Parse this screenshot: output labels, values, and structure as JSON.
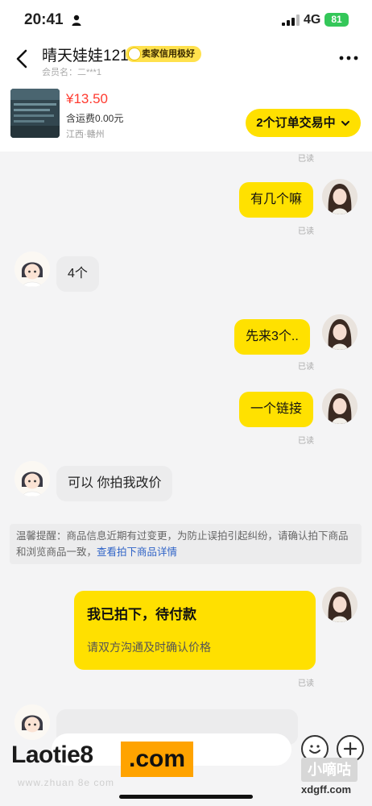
{
  "status_bar": {
    "time": "20:41",
    "network": "4G",
    "battery": "81"
  },
  "header": {
    "title": "晴天娃娃121",
    "seller_badge": "卖家信用极好",
    "subtitle": "会员名：二***1"
  },
  "product": {
    "price": "¥13.50",
    "shipping": "含运费0.00元",
    "location": "江西·赣州",
    "orders_button": "2个订单交易中"
  },
  "chat": {
    "top_read": "已读",
    "messages": [
      {
        "from": "me",
        "text": "有几个嘛",
        "status": "已读"
      },
      {
        "from": "other",
        "text": "4个"
      },
      {
        "from": "me",
        "text": "先来3个..",
        "status": "已读"
      },
      {
        "from": "me",
        "text": "一个链接",
        "status": "已读"
      },
      {
        "from": "other",
        "text": "可以 你拍我改价"
      }
    ],
    "tip": {
      "text": "温馨提醒：商品信息近期有过变更，为防止误拍引起纠纷，请确认拍下商品和浏览商品一致，",
      "link": "查看拍下商品详情"
    },
    "order_card": {
      "title": "我已拍下，待付款",
      "desc": "请双方沟通及时确认价格",
      "status": "已读"
    }
  },
  "watermarks": {
    "left_brand": "Laotie8",
    "left_domain": ".com",
    "left_sub": "www.zhuan 8e com",
    "right_cn": "小嘀咕",
    "right_url": "xdgff.com"
  },
  "colors": {
    "accent_yellow": "#ffe000",
    "price_red": "#ff3b30",
    "link_blue": "#2f63c7",
    "battery_green": "#34c759",
    "background": "#f4f4f5"
  },
  "icons": [
    "person-icon",
    "signal-icon",
    "back-arrow-icon",
    "more-icon",
    "chevron-down-icon",
    "emoji-icon",
    "plus-icon"
  ]
}
